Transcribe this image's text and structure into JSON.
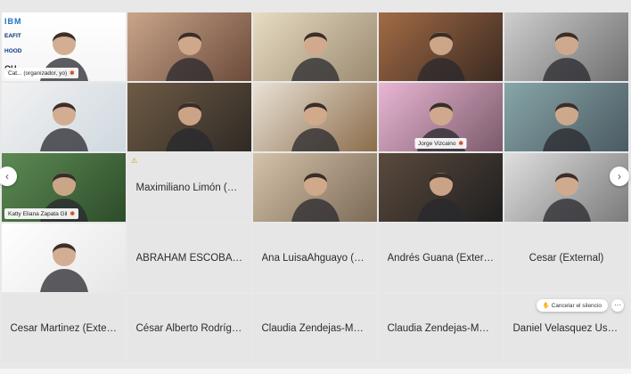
{
  "grid": {
    "tiles": [
      {
        "type": "video",
        "name": "Cat... (organizador, yo)",
        "scene": "white",
        "logos": {
          "ibm": "IBM",
          "eafit": "EAFIT",
          "hood": "HOOD",
          "qh": "QH"
        }
      },
      {
        "type": "video",
        "name": "",
        "scene": "room-warm"
      },
      {
        "type": "video",
        "name": "",
        "scene": "room-light"
      },
      {
        "type": "video",
        "name": "",
        "scene": "shelf-warm"
      },
      {
        "type": "video",
        "name": "",
        "scene": "room-gray"
      },
      {
        "type": "video",
        "name": "",
        "scene": "bright"
      },
      {
        "type": "video",
        "name": "",
        "scene": "bookshelf"
      },
      {
        "type": "video",
        "name": "",
        "scene": "sunflower"
      },
      {
        "type": "video",
        "name": "Jorge Vizcaino",
        "scene": "pink"
      },
      {
        "type": "video",
        "name": "",
        "scene": "street"
      },
      {
        "type": "video",
        "name": "Katty Eliana Zapata Gil",
        "scene": "park"
      },
      {
        "type": "name",
        "name": "Maximiliano Limón (Ex..."
      },
      {
        "type": "video",
        "name": "",
        "scene": "frames"
      },
      {
        "type": "video",
        "name": "",
        "scene": "office-dark"
      },
      {
        "type": "video",
        "name": "",
        "scene": "mirror"
      },
      {
        "type": "video",
        "name": "",
        "scene": "white-room"
      },
      {
        "type": "name",
        "name": "ABRAHAM ESCOBAR..."
      },
      {
        "type": "name",
        "name": "Ana LuisaAhguayo (Ex..."
      },
      {
        "type": "name",
        "name": "Andrés Guana (Extern..."
      },
      {
        "type": "name",
        "name": "Cesar (External)"
      },
      {
        "type": "name",
        "name": "Cesar Martinez (Exter..."
      },
      {
        "type": "name",
        "name": "César Alberto Rodrígu..."
      },
      {
        "type": "name",
        "name": "Claudia Zendejas-Mor..."
      },
      {
        "type": "name",
        "name": "Claudia Zendejas-Mor..."
      },
      {
        "type": "name",
        "name": "Daniel Velasquez Usu..."
      }
    ]
  },
  "controls": {
    "prev_icon": "‹",
    "next_icon": "›",
    "unmute_label": "Cancelar el silencio",
    "more_icon": "⋯",
    "warning_icon": "⚠",
    "mute_icon": "✱"
  }
}
